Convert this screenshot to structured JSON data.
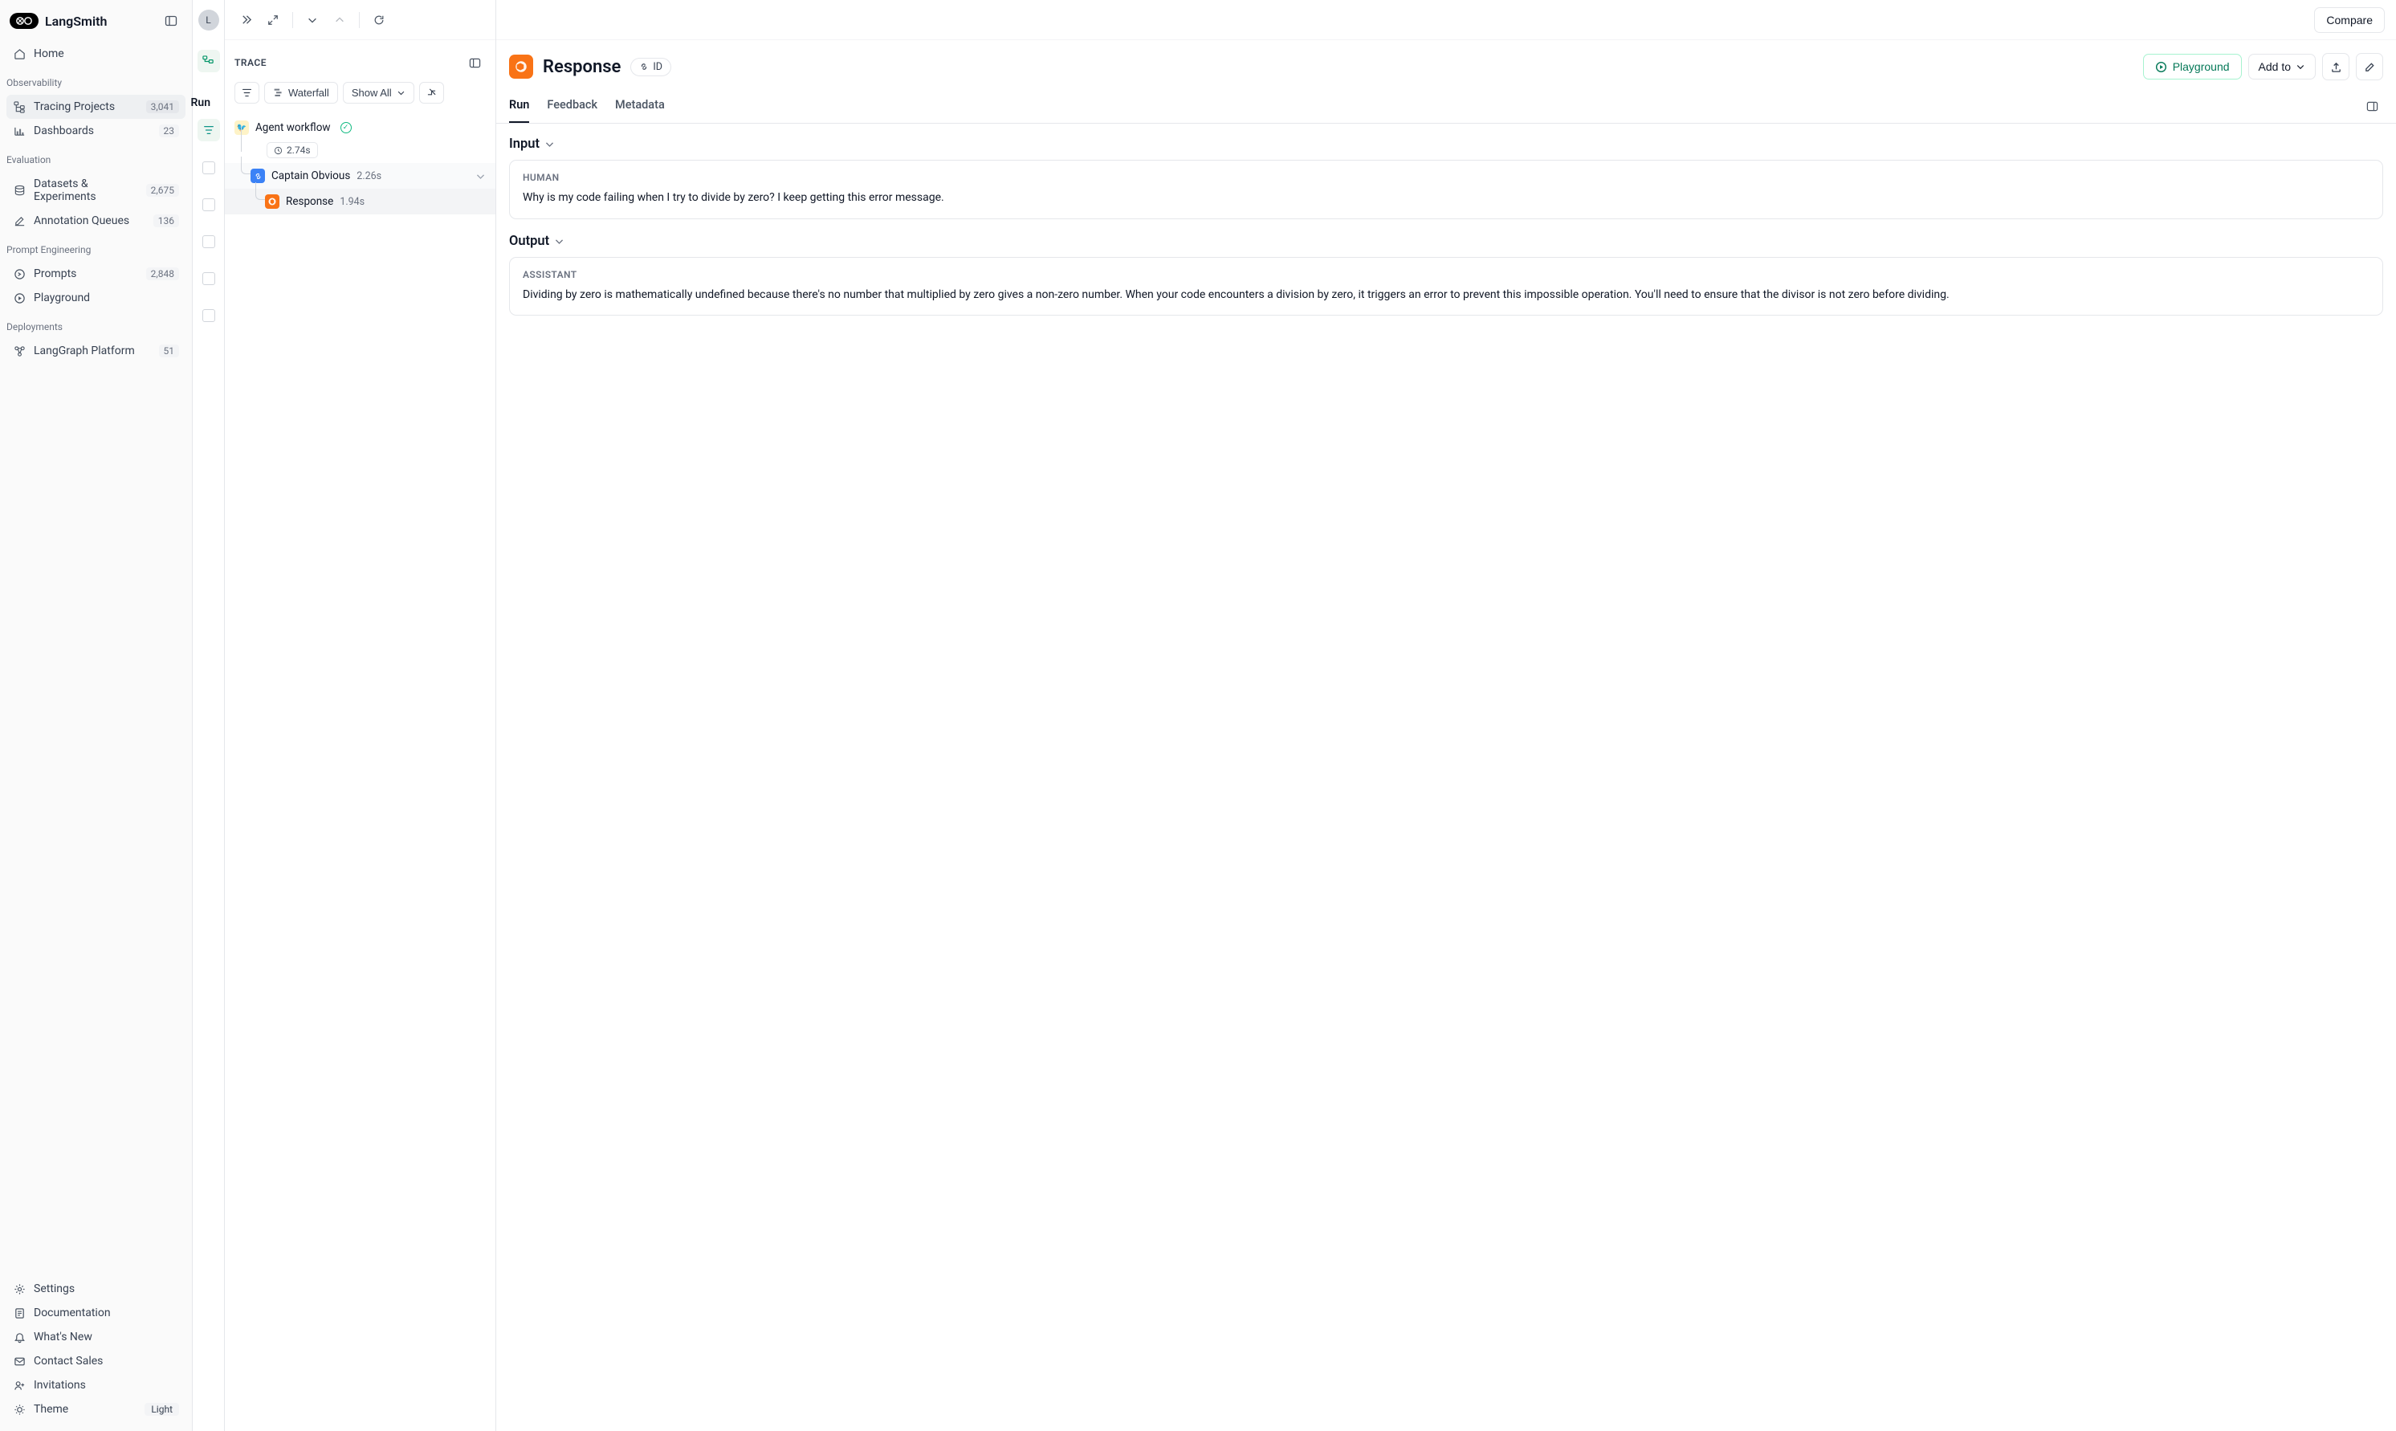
{
  "brand": "LangSmith",
  "sidebar": {
    "home": "Home",
    "sections": {
      "observability": {
        "label": "Observability",
        "items": [
          {
            "label": "Tracing Projects",
            "count": "3,041"
          },
          {
            "label": "Dashboards",
            "count": "23"
          }
        ]
      },
      "evaluation": {
        "label": "Evaluation",
        "items": [
          {
            "label": "Datasets & Experiments",
            "count": "2,675"
          },
          {
            "label": "Annotation Queues",
            "count": "136"
          }
        ]
      },
      "prompt": {
        "label": "Prompt Engineering",
        "items": [
          {
            "label": "Prompts",
            "count": "2,848"
          },
          {
            "label": "Playground"
          }
        ]
      },
      "deployments": {
        "label": "Deployments",
        "items": [
          {
            "label": "LangGraph Platform",
            "count": "51"
          }
        ]
      }
    },
    "bottom": {
      "settings": "Settings",
      "documentation": "Documentation",
      "whatsnew": "What's New",
      "contact": "Contact Sales",
      "invitations": "Invitations",
      "theme": "Theme",
      "theme_value": "Light"
    }
  },
  "avatar_initial": "L",
  "runs_header": "Run",
  "trace": {
    "title": "TRACE",
    "waterfall": "Waterfall",
    "show_all": "Show All",
    "root": {
      "name": "Agent workflow",
      "time": "2.74s"
    },
    "child1": {
      "name": "Captain Obvious",
      "time": "2.26s"
    },
    "child2": {
      "name": "Response",
      "time": "1.94s"
    }
  },
  "detail": {
    "compare": "Compare",
    "title": "Response",
    "id_label": "ID",
    "playground": "Playground",
    "add_to": "Add to",
    "tabs": {
      "run": "Run",
      "feedback": "Feedback",
      "metadata": "Metadata"
    },
    "input": {
      "heading": "Input",
      "role": "HUMAN",
      "text": "Why is my code failing when I try to divide by zero? I keep getting this error message."
    },
    "output": {
      "heading": "Output",
      "role": "ASSISTANT",
      "text": "Dividing by zero is mathematically undefined because there's no number that multiplied by zero gives a non-zero number. When your code encounters a division by zero, it triggers an error to prevent this impossible operation. You'll need to ensure that the divisor is not zero before dividing."
    }
  }
}
